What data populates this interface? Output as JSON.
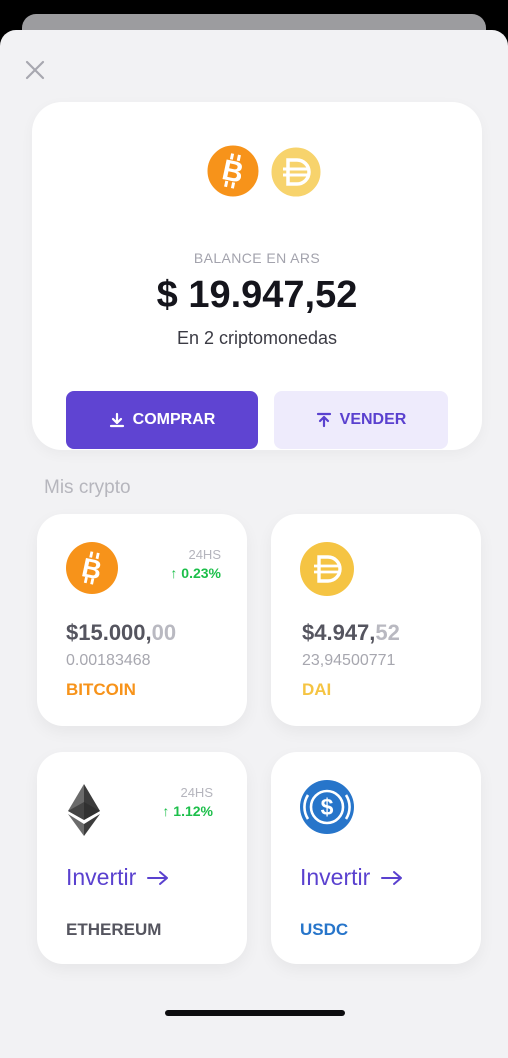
{
  "balance": {
    "label": "BALANCE EN ARS",
    "value": "$ 19.947,52",
    "subtitle": "En 2 criptomonedas",
    "coin_icons": [
      "bitcoin-icon",
      "dai-icon"
    ]
  },
  "actions": {
    "buy_label": "COMPRAR",
    "sell_label": "VENDER"
  },
  "section": {
    "title": "Mis crypto"
  },
  "colors": {
    "accent": "#5f44d2",
    "bitcoin": "#f7931a",
    "dai": "#f5c443",
    "positive": "#1cbf4a",
    "usdc": "#2775ca"
  },
  "cards": [
    {
      "icon": "bitcoin-icon",
      "period": "24HS",
      "change": "0.23%",
      "price_main": "$15.000,",
      "price_cents": "00",
      "quantity": "0.00183468",
      "name": "BITCOIN"
    },
    {
      "icon": "dai-icon",
      "price_main": "$4.947,",
      "price_cents": "52",
      "quantity": "23,94500771",
      "name": "DAI"
    },
    {
      "icon": "ethereum-icon",
      "period": "24HS",
      "change": "1.12%",
      "invest_label": "Invertir",
      "name": "ETHEREUM"
    },
    {
      "icon": "usdc-icon",
      "invest_label": "Invertir",
      "name": "USDC"
    }
  ]
}
